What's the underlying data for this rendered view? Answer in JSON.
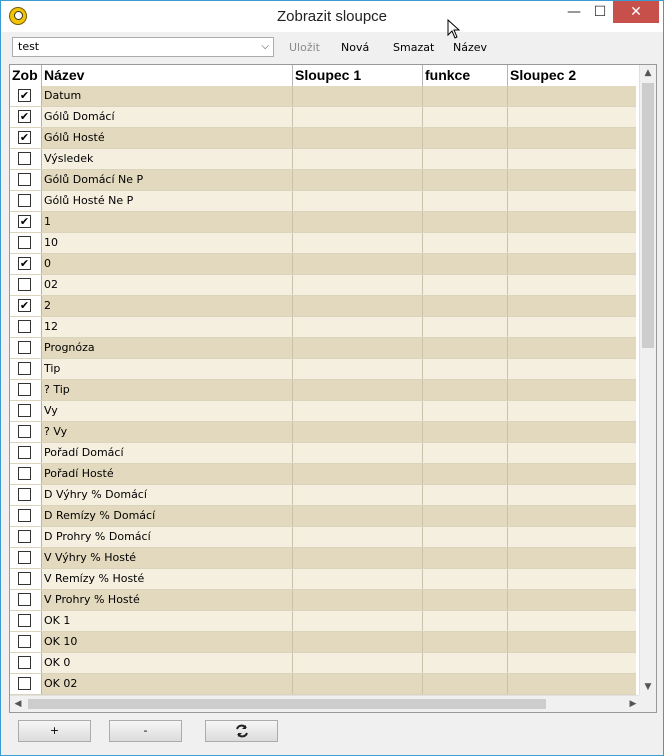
{
  "window": {
    "title": "Zobrazit sloupce",
    "minimize_label": "—",
    "maximize_label": "☐",
    "close_label": "✕"
  },
  "toolbar": {
    "combo_value": "test",
    "save_label": "Uložit",
    "new_label": "Nová",
    "delete_label": "Smazat",
    "name_label": "Název"
  },
  "grid": {
    "headers": [
      "Zob",
      "Název",
      "Sloupec 1",
      "funkce",
      "Sloupec 2"
    ],
    "rows": [
      {
        "checked": true,
        "name": "Datum"
      },
      {
        "checked": true,
        "name": "Gólů Domácí"
      },
      {
        "checked": true,
        "name": "Gólů Hosté"
      },
      {
        "checked": false,
        "name": "Výsledek"
      },
      {
        "checked": false,
        "name": "Gólů Domácí Ne P"
      },
      {
        "checked": false,
        "name": "Gólů Hosté Ne P"
      },
      {
        "checked": true,
        "name": "1"
      },
      {
        "checked": false,
        "name": "10"
      },
      {
        "checked": true,
        "name": "0"
      },
      {
        "checked": false,
        "name": "02"
      },
      {
        "checked": true,
        "name": "2"
      },
      {
        "checked": false,
        "name": "12"
      },
      {
        "checked": false,
        "name": "Prognóza"
      },
      {
        "checked": false,
        "name": "Tip"
      },
      {
        "checked": false,
        "name": "? Tip"
      },
      {
        "checked": false,
        "name": "Vy"
      },
      {
        "checked": false,
        "name": "? Vy"
      },
      {
        "checked": false,
        "name": "Pořadí Domácí"
      },
      {
        "checked": false,
        "name": "Pořadí Hosté"
      },
      {
        "checked": false,
        "name": "D Výhry % Domácí"
      },
      {
        "checked": false,
        "name": "D Remízy % Domácí"
      },
      {
        "checked": false,
        "name": "D Prohry % Domácí"
      },
      {
        "checked": false,
        "name": "V Výhry % Hosté"
      },
      {
        "checked": false,
        "name": "V Remízy % Hosté"
      },
      {
        "checked": false,
        "name": "V Prohry % Hosté"
      },
      {
        "checked": false,
        "name": "OK 1"
      },
      {
        "checked": false,
        "name": "OK 10"
      },
      {
        "checked": false,
        "name": "OK 0"
      },
      {
        "checked": false,
        "name": "OK 02"
      },
      {
        "checked": false,
        "name": ""
      }
    ]
  },
  "bottom": {
    "add_label": "+",
    "remove_label": "-",
    "refresh_icon": "refresh-icon"
  }
}
